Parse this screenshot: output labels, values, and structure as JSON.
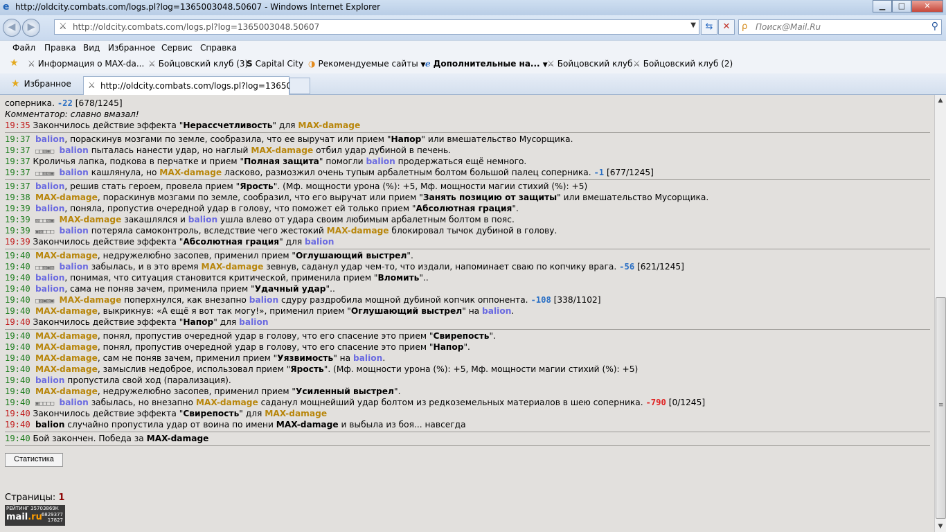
{
  "window": {
    "title": "http://oldcity.combats.com/logs.pl?log=1365003048.50607 - Windows Internet Explorer",
    "min_glyph": "▁",
    "max_glyph": "□",
    "close_glyph": "✕"
  },
  "nav": {
    "back_glyph": "◀",
    "forward_glyph": "▶",
    "address": "http://oldcity.combats.com/logs.pl?log=1365003048.50607",
    "search_placeholder": "Поиск@Mail.Ru"
  },
  "menu": [
    "Файл",
    "Правка",
    "Вид",
    "Избранное",
    "Сервис",
    "Справка"
  ],
  "favorites": [
    "Информация о MAX-da...",
    "Бойцовский клуб (3)",
    "Capital City",
    "Рекомендуемые сайты",
    "Дополнительные на...",
    "Бойцовский клуб",
    "Бойцовский клуб (2)"
  ],
  "tabs": {
    "favorites_label": "Избранное",
    "active_tab": "http://oldcity.combats.com/logs.pl?log=1365003..."
  },
  "fighters": {
    "p1": "MAX-damage",
    "p2": "balion"
  },
  "log": {
    "l01": {
      "a": "соперника. ",
      "dmg": "-22",
      "hp": " [678/1245]"
    },
    "l02": "Комментатор: славно вмазал!",
    "l03": {
      "t": "19:35",
      "a": " Закончилось действие эффекта \"",
      "e": "Нерассчетливость",
      "b": "\" для "
    },
    "l04": {
      "t": "19:37",
      "a": ", пораскинув мозгами по земле, сообразила, что ее выручат или прием \"",
      "e": "Напор",
      "b": "\" или вмешательство Мусорщика."
    },
    "l05": {
      "t": "19:37",
      "sq": "□□▧▣□",
      "a": " пыталась нанести удар, но наглый ",
      "b": " отбил удар дубиной в печень."
    },
    "l06": {
      "t": "19:37",
      "a": " Кроличья лапка, подкова в перчатке и прием \"",
      "e": "Полная защита",
      "b": "\" помогли ",
      "c": " продержаться ещё немного."
    },
    "l07": {
      "t": "19:37",
      "sq": "□□▨▧▣",
      "a": " кашлянула, но ",
      "b": " ласково, размозжил очень тупым арбалетным болтом большой палец соперника. ",
      "dmg": "-1",
      "hp": " [677/1245]"
    },
    "l08": {
      "t": "19:37",
      "a": ", решив стать героем, провела прием \"",
      "e": "Ярость",
      "b": "\". (Мф. мощности урона (%): +5, Мф. мощности магии стихий (%): +5)"
    },
    "l09": {
      "t": "19:38",
      "a": ", пораскинув мозгами по земле, сообразил, что его выручат или прием \"",
      "e": "Занять позицию от защиты",
      "b": "\" или вмешательство Мусорщика."
    },
    "l10": {
      "t": "19:39",
      "a": ", поняла, пропустив очередной удар в голову, что поможет ей только прием \"",
      "e": "Абсолютная грация",
      "b": "\"."
    },
    "l11": {
      "t": "19:39",
      "sq": "▨□□▧▣",
      "a": " закашлялся и ",
      "b": " ушла влево от удара своим любимым арбалетным болтом в пояс."
    },
    "l12": {
      "t": "19:39",
      "sq": "▣▧□□□",
      "a": " потеряла самоконтроль, вследствие чего жестокий ",
      "b": " блокировал тычок дубиной в голову."
    },
    "l13": {
      "t": "19:39",
      "a": " Закончилось действие эффекта \"",
      "e": "Абсолютная грация",
      "b": "\" для "
    },
    "l14": {
      "t": "19:40",
      "a": ", недружелюбно засопев, применил прием \"",
      "e": "Оглушающий выстрел",
      "b": "\"."
    },
    "l15": {
      "t": "19:40",
      "sq": "□□▨▣▧",
      "a": " забылась, и в это время ",
      "b": " зевнув, саданул удар чем-то, что издали, напоминает сваю по копчику врага. ",
      "dmg": "-56",
      "hp": " [621/1245]"
    },
    "l16": {
      "t": "19:40",
      "a": ", понимая, что ситуация становится критической, применила прием \"",
      "e": "Вломить",
      "b": "\".."
    },
    "l17": {
      "t": "19:40",
      "a": ", сама не поняв зачем, применила прием \"",
      "e": "Удачный удар",
      "b": "\".."
    },
    "l18": {
      "t": "19:40",
      "sq": "□▨▣▧▣",
      "a": " поперхнулся, как внезапно ",
      "b": " сдуру раздробила мощной дубиной копчик оппонента. ",
      "dmg": "-108",
      "hp": " [338/1102]"
    },
    "l19": {
      "t": "19:40",
      "a": ", выкрикнув: «А ещё я вот так могу!», применил прием \"",
      "e": "Оглушающий выстрел",
      "b": "\" на "
    },
    "l20": {
      "t": "19:40",
      "a": " Закончилось действие эффекта \"",
      "e": "Напор",
      "b": "\" для "
    },
    "l21": {
      "t": "19:40",
      "a": ", понял, пропустив очередной удар в голову, что его спасение это прием \"",
      "e": "Свирепость",
      "b": "\"."
    },
    "l22": {
      "t": "19:40",
      "a": ", понял, пропустив очередной удар в голову, что его спасение это прием \"",
      "e": "Напор",
      "b": "\"."
    },
    "l23": {
      "t": "19:40",
      "a": ", сам не поняв зачем, применил прием \"",
      "e": "Уязвимость",
      "b": "\" на "
    },
    "l24": {
      "t": "19:40",
      "a": ", замыслив недоброе, использовал прием \"",
      "e": "Ярость",
      "b": "\". (Мф. мощности урона (%): +5, Мф. мощности магии стихий (%): +5)"
    },
    "l25": {
      "t": "19:40",
      "a": " пропустила свой ход (парализация)."
    },
    "l26": {
      "t": "19:40",
      "a": ", недружелюбно засопев, применил прием \"",
      "e": "Усиленный выстрел",
      "b": "\"."
    },
    "l27": {
      "t": "19:40",
      "sq": "▣□□□□",
      "a": " забылась, но внезапно ",
      "b": " саданул мощнейший удар болтом из редкоземельных материалов в шею соперника. ",
      "dmg": "-790",
      "hp": " [0/1245]"
    },
    "l28": {
      "t": "19:40",
      "a": " Закончилось действие эффекта \"",
      "e": "Свирепость",
      "b": "\" для "
    },
    "l29": {
      "t": "19:40",
      "a": " случайно пропустила удар от воина по имени ",
      "b": " и выбыла из боя... навсегда"
    },
    "l30": {
      "t": "19:40",
      "a": " Бой закончен. Победа за "
    }
  },
  "stats_button": "Статистика",
  "pages": {
    "label": "Страницы:",
    "current": "1"
  },
  "counter": {
    "title": "РЕЙТИНГ 35703869К",
    "logo_a": "mail",
    "logo_b": ".ru",
    "n1": "6829377",
    "n2": "17827"
  },
  "icons": {
    "ie": "ie-logo-icon",
    "back": "back-arrow-icon",
    "forward": "forward-arrow-icon",
    "refresh": "refresh-icon",
    "stop": "stop-icon",
    "search": "search-icon",
    "favorites": "star-icon",
    "swords": "crossed-swords-icon"
  },
  "colors": {
    "p1": "#b8860b",
    "p2": "#6a6ae0",
    "time_green": "#1c7c1c",
    "time_red": "#c01818",
    "dmg_blue": "#2a6fc4",
    "dmg_red": "#e02020"
  }
}
